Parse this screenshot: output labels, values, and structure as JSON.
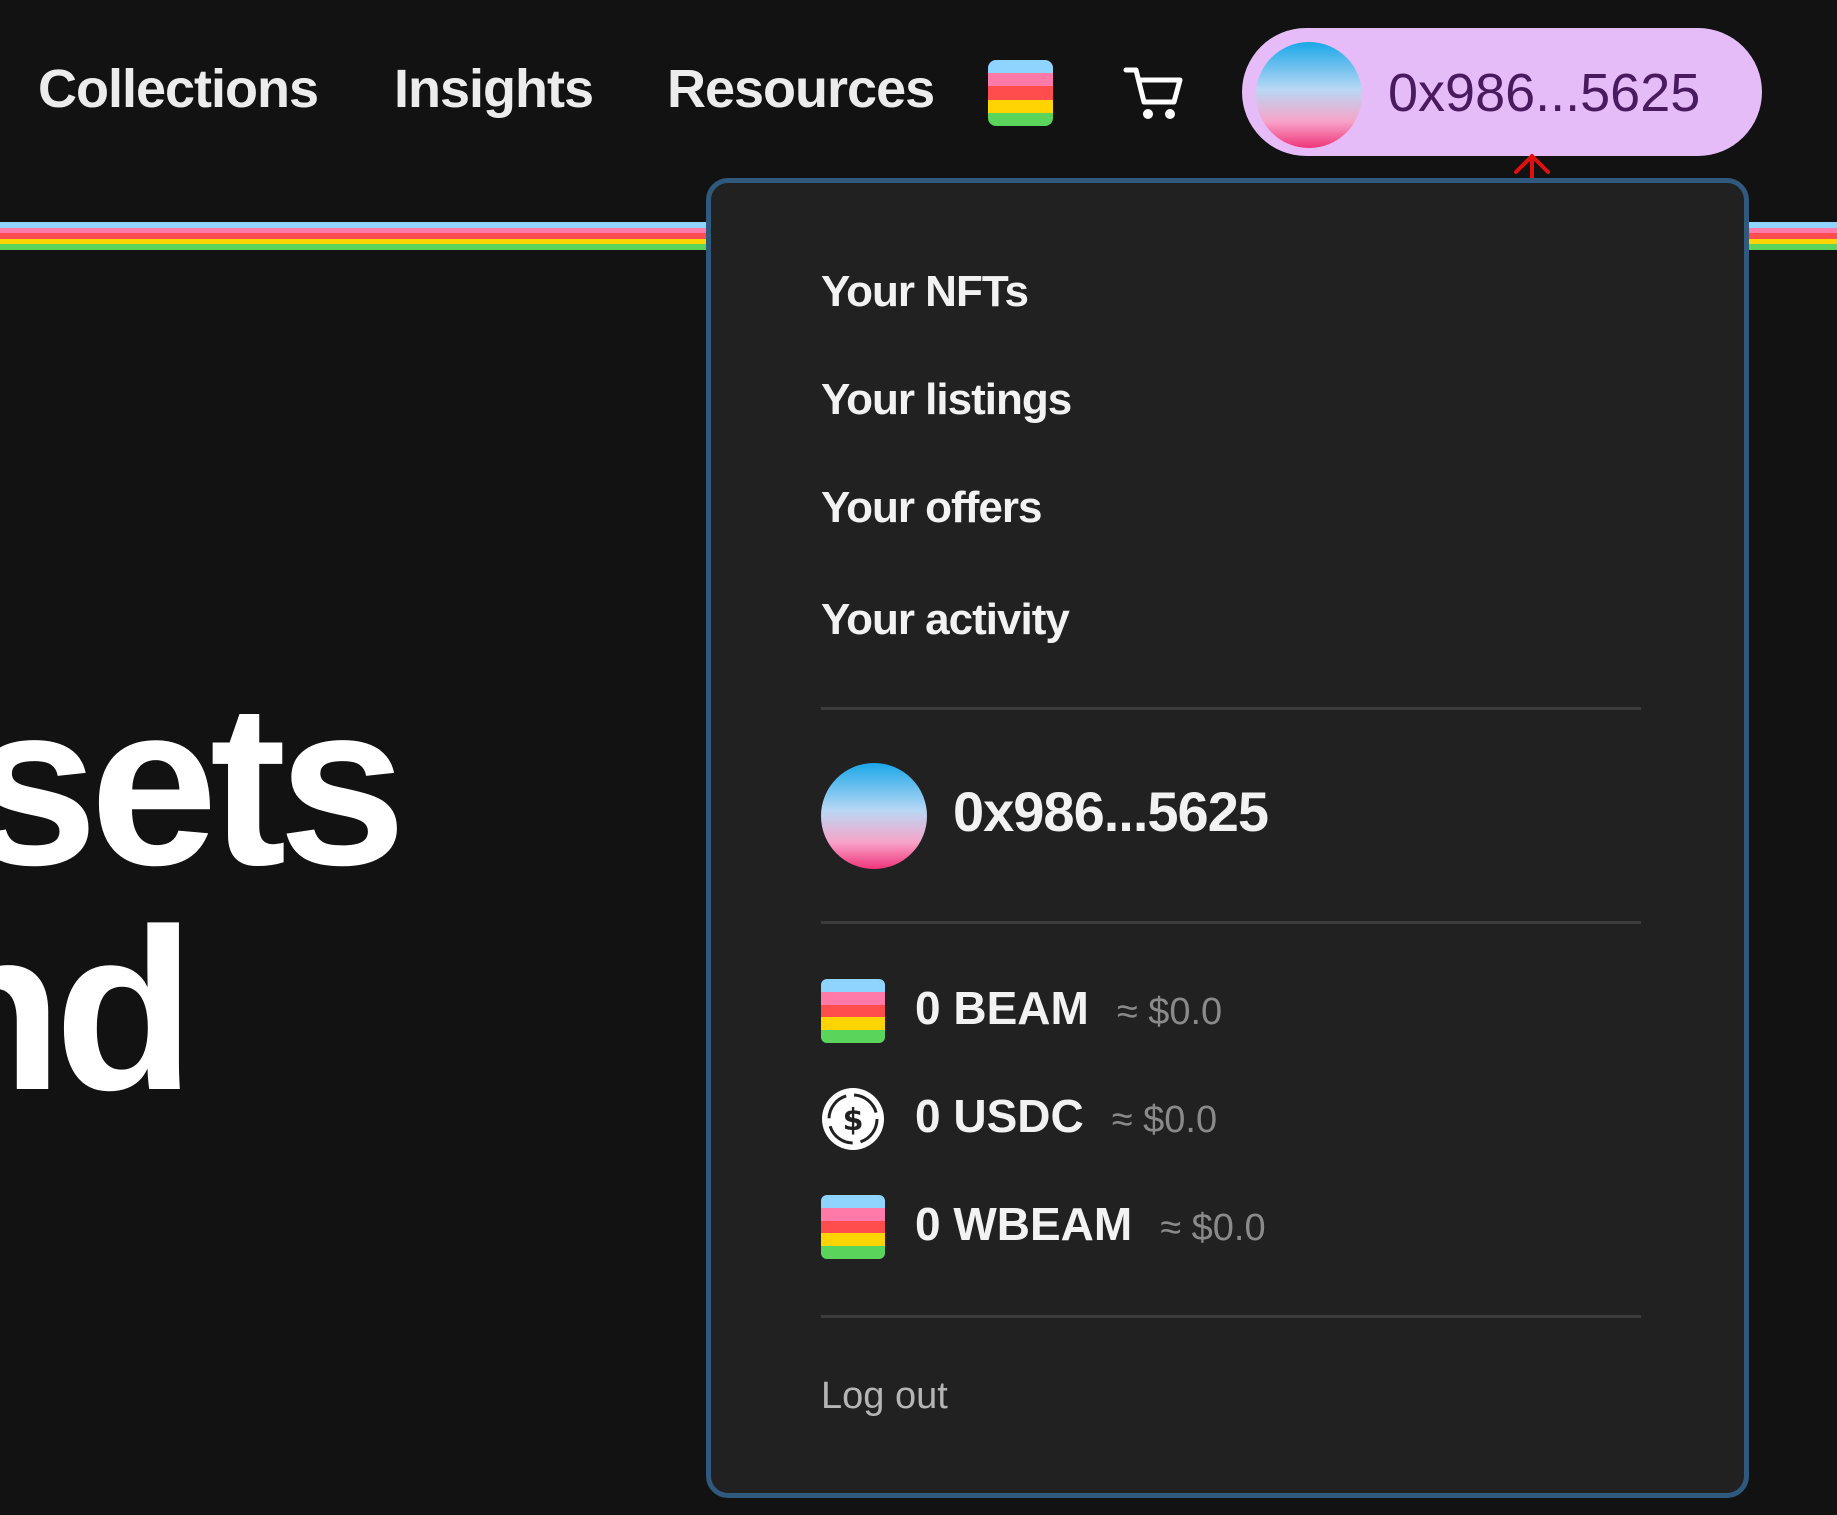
{
  "nav": {
    "collections": "Collections",
    "insights": "Insights",
    "resources": "Resources"
  },
  "wallet": {
    "address": "0x986...5625"
  },
  "hero": {
    "line1": "sets",
    "line2": "nd"
  },
  "menu": {
    "items": [
      "Your NFTs",
      "Your listings",
      "Your offers",
      "Your activity"
    ],
    "account_address": "0x986...5625",
    "tokens": [
      {
        "amount": "0 BEAM",
        "usd": "≈ $0.0",
        "icon": "beam-icon"
      },
      {
        "amount": "0 USDC",
        "usd": "≈ $0.0",
        "icon": "usdc-icon"
      },
      {
        "amount": "0 WBEAM",
        "usd": "≈ $0.0",
        "icon": "wbeam-icon"
      }
    ],
    "logout": "Log out"
  },
  "colors": {
    "background": "#121212",
    "menu_background": "#212121",
    "menu_border": "#2f5a7e",
    "wallet_pill": "#e6bcf8",
    "stripe_colors": [
      "#8fd3ff",
      "#ff7aa8",
      "#ff4d4d",
      "#ffd400",
      "#5bd45b"
    ]
  }
}
